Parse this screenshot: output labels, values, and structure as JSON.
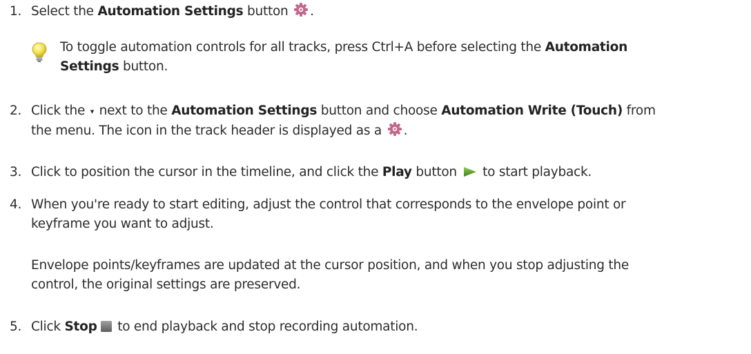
{
  "steps": [
    {
      "number": "1.",
      "t1": "Select the ",
      "b1": "Automation Settings",
      "t2": " button ",
      "t3": "."
    },
    {
      "number": "2.",
      "t1": "Click the ",
      "caret": "▾",
      "t2": " next to the ",
      "b1": "Automation Settings",
      "t3": " button and choose ",
      "b2": "Automation Write (Touch)",
      "t4": " from",
      "t5": "the menu. The icon in the track header is displayed as a ",
      "t6": "."
    },
    {
      "number": "3.",
      "t1": "Click to position the cursor in the timeline, and click the ",
      "b1": "Play",
      "t2": " button ",
      "t3": " to start playback."
    },
    {
      "number": "4.",
      "l1": "When you're ready to start editing, adjust the control that corresponds to the envelope point or",
      "l2": "keyframe you want to adjust."
    },
    {
      "number": "5.",
      "t1": "Click ",
      "b1": "Stop",
      "t2": " to end playback and stop recording automation."
    }
  ],
  "tip": {
    "t1": "To toggle automation controls for all tracks, press Ctrl+A before selecting the ",
    "b1": "Automation",
    "b2": "Settings",
    "t2": " button."
  },
  "step4_note": {
    "l1": "Envelope points/keyframes are updated at the cursor position, and when you stop adjusting the",
    "l2": "control, the original settings are preserved."
  },
  "icons": {
    "automation_settings": "gear-icon",
    "automation_write_touch": "gear-icon",
    "tip": "lightbulb-icon",
    "play": "play-icon",
    "stop": "stop-icon",
    "dropdown": "chevron-down-icon"
  },
  "colors": {
    "gear": "#c0688c",
    "gear_center": "#ffffff",
    "play": "#5a9a2e",
    "stop": "#7a7a7a",
    "bulb": "#f3e24a"
  }
}
